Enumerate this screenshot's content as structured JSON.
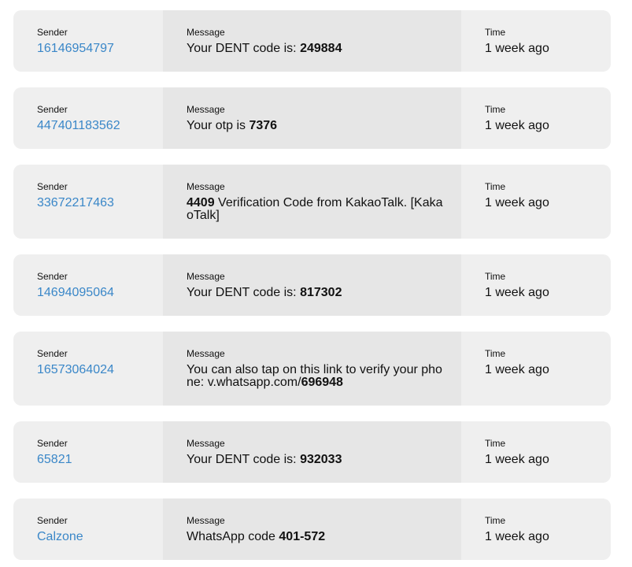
{
  "labels": {
    "sender": "Sender",
    "message": "Message",
    "time": "Time"
  },
  "colors": {
    "card_bg": "#efefef",
    "message_bg": "#e6e6e6",
    "sender_link": "#3a87c8"
  },
  "messages": [
    {
      "sender": "16146954797",
      "pre": "Your DENT code is: ",
      "code": "249884",
      "post": "",
      "time": "1 week ago"
    },
    {
      "sender": "447401183562",
      "pre": "Your otp is ",
      "code": "7376",
      "post": "",
      "time": "1 week ago"
    },
    {
      "sender": "33672217463",
      "pre": "",
      "code": "4409",
      "post": " Verification Code from KakaoTalk. [KakaoTalk]",
      "time": "1 week ago"
    },
    {
      "sender": "14694095064",
      "pre": "Your DENT code is: ",
      "code": "817302",
      "post": "",
      "time": "1 week ago"
    },
    {
      "sender": "16573064024",
      "pre": "You can also tap on this link to verify your phone: v.whatsapp.com/",
      "code": "696948",
      "post": "",
      "time": "1 week ago"
    },
    {
      "sender": "65821",
      "pre": "Your DENT code is: ",
      "code": "932033",
      "post": "",
      "time": "1 week ago"
    },
    {
      "sender": "Calzone",
      "pre": "WhatsApp code ",
      "code": "401-572",
      "post": "",
      "time": "1 week ago"
    }
  ]
}
